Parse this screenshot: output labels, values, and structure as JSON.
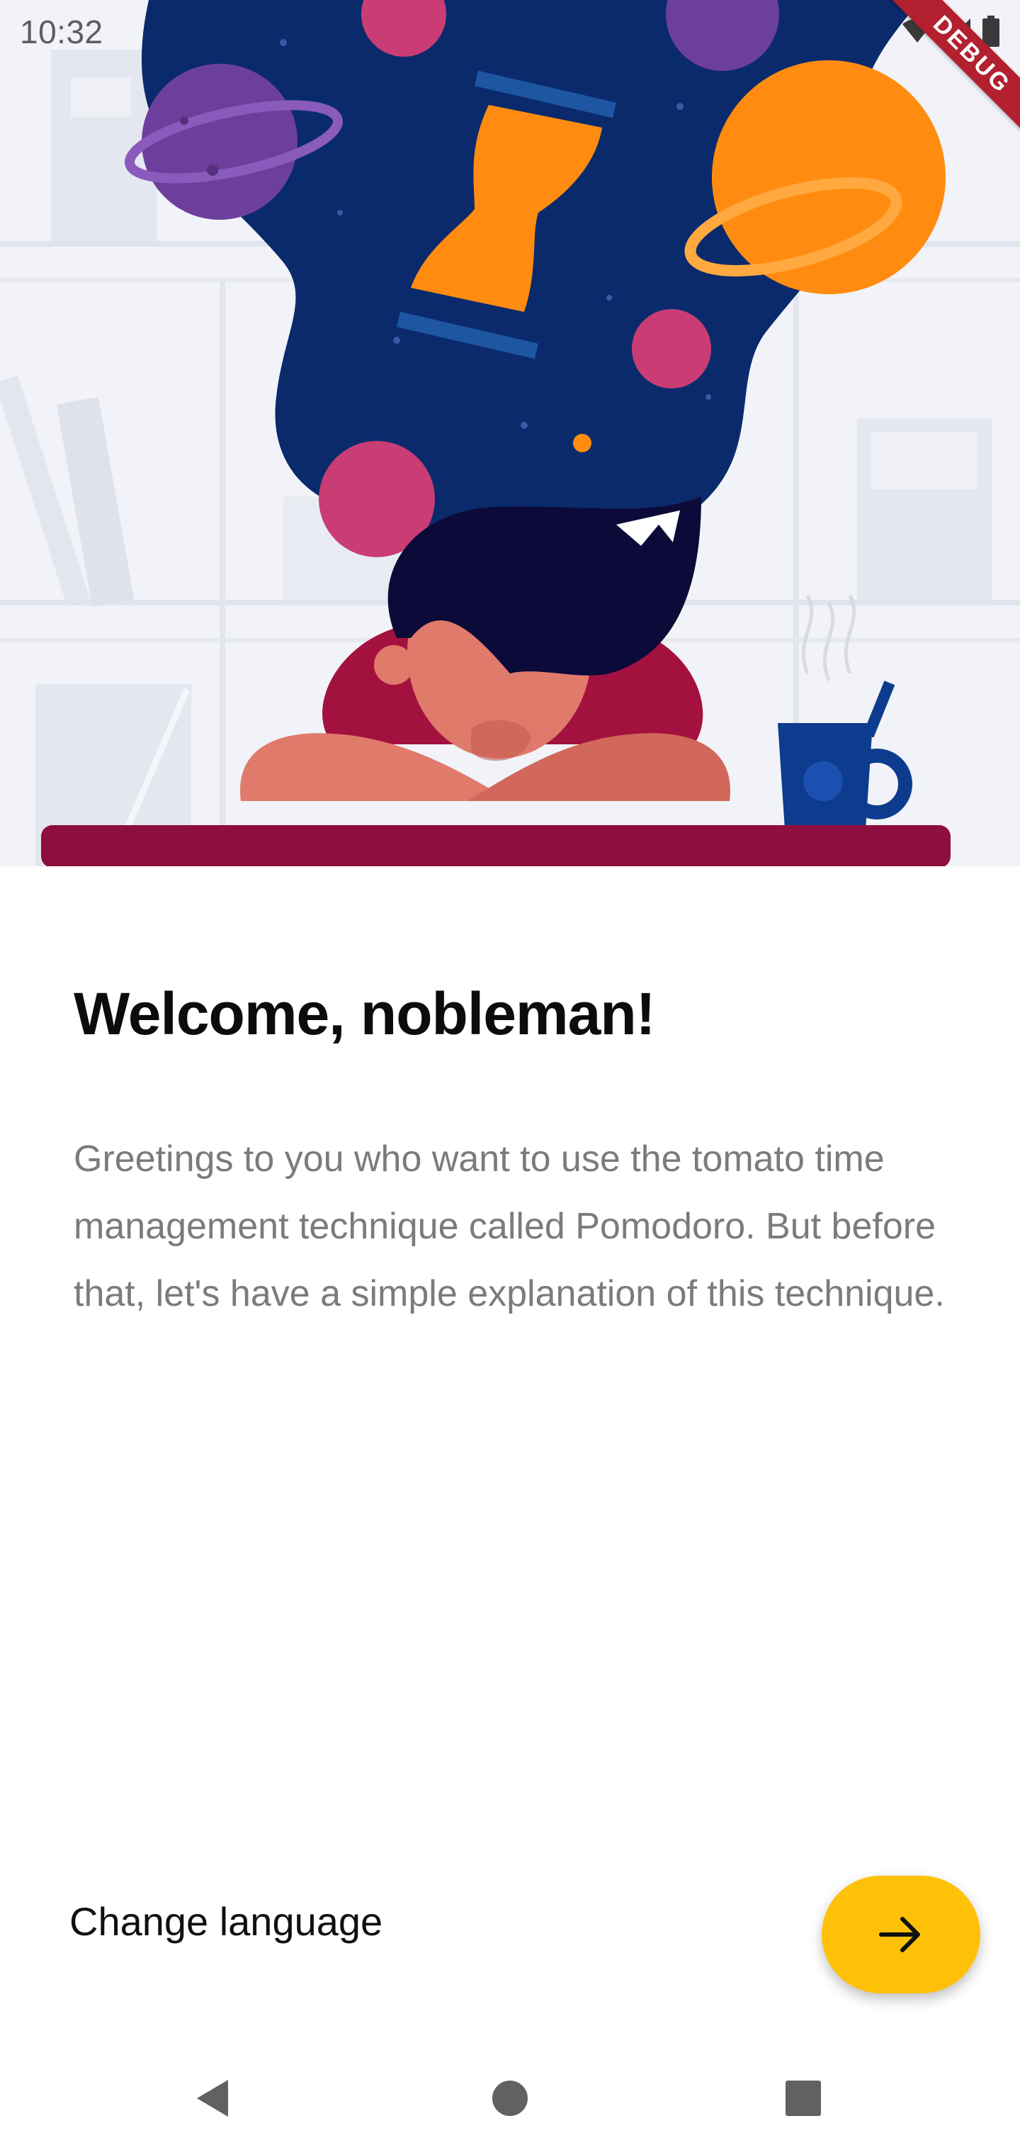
{
  "status_bar": {
    "time": "10:32",
    "icons": [
      "wifi-icon",
      "signal-icon",
      "battery-icon"
    ]
  },
  "debug_banner": {
    "label": "DEBUG"
  },
  "hero": {
    "illustration": "person-dreaming-space-hourglass",
    "icons": [
      "hourglass-icon",
      "coffee-mug-icon"
    ]
  },
  "welcome": {
    "title": "Welcome, nobleman!",
    "description": "Greetings to you who want to use the tomato time management technique called Pomodoro. But before that, let's have a simple explanation of this technique."
  },
  "actions": {
    "change_language": "Change language",
    "next_icon": "arrow-right-icon"
  },
  "nav_bar": {
    "icons": [
      "back-icon",
      "home-icon",
      "recents-icon"
    ]
  },
  "colors": {
    "accent": "#ffc107",
    "space": "#0a2a6c",
    "desk": "#8e0f3f",
    "title": "#0c0c0c",
    "body_text": "#7a7b7e"
  }
}
